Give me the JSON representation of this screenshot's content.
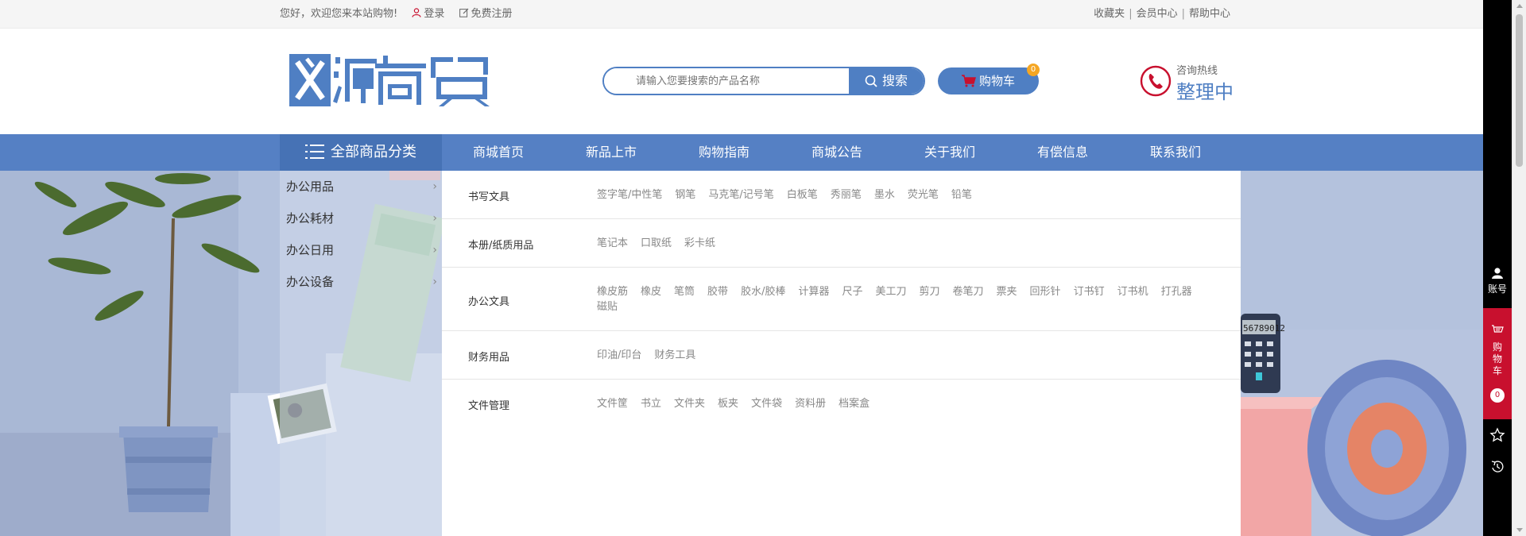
{
  "topbar": {
    "greeting": "您好，欢迎您来本站购物!",
    "login": "登录",
    "register": "免费注册",
    "favorites": "收藏夹",
    "member_center": "会员中心",
    "help_center": "帮助中心",
    "sep": "|"
  },
  "header": {
    "logo_text": "义源商贸",
    "search_placeholder": "请输入您要搜索的产品名称",
    "search_button": "搜索",
    "cart_label": "购物车",
    "cart_count": "0",
    "hotline_label": "咨询热线",
    "hotline_value": "整理中"
  },
  "nav": {
    "all_categories": "全部商品分类",
    "items": [
      "商城首页",
      "新品上市",
      "购物指南",
      "商城公告",
      "关于我们",
      "有偿信息",
      "联系我们"
    ]
  },
  "side_categories": [
    "办公用品",
    "办公耗材",
    "办公日用",
    "办公设备"
  ],
  "category_panel": [
    {
      "title": "书写文具",
      "links": [
        "签字笔/中性笔",
        "钢笔",
        "马克笔/记号笔",
        "白板笔",
        "秀丽笔",
        "墨水",
        "荧光笔",
        "铅笔"
      ]
    },
    {
      "title": "本册/纸质用品",
      "links": [
        "笔记本",
        "口取纸",
        "彩卡纸"
      ]
    },
    {
      "title": "办公文具",
      "links": [
        "橡皮筋",
        "橡皮",
        "笔筒",
        "胶带",
        "胶水/胶棒",
        "计算器",
        "尺子",
        "美工刀",
        "剪刀",
        "卷笔刀",
        "票夹",
        "回形针",
        "订书钉",
        "订书机",
        "打孔器",
        "磁贴"
      ]
    },
    {
      "title": "财务用品",
      "links": [
        "印油/印台",
        "财务工具"
      ]
    },
    {
      "title": "文件管理",
      "links": [
        "文件筐",
        "书立",
        "文件夹",
        "板夹",
        "文件袋",
        "资料册",
        "档案盒"
      ]
    }
  ],
  "right_bar": {
    "account": "账号",
    "cart": [
      "购",
      "物",
      "车"
    ],
    "cart_count": "0"
  },
  "banner": {
    "calculator_display": "56789012"
  },
  "colors": {
    "brand_blue": "#5580c4",
    "dark_blue": "#4672b5",
    "hot_red": "#c8102e",
    "badge_orange": "#f5a623"
  }
}
